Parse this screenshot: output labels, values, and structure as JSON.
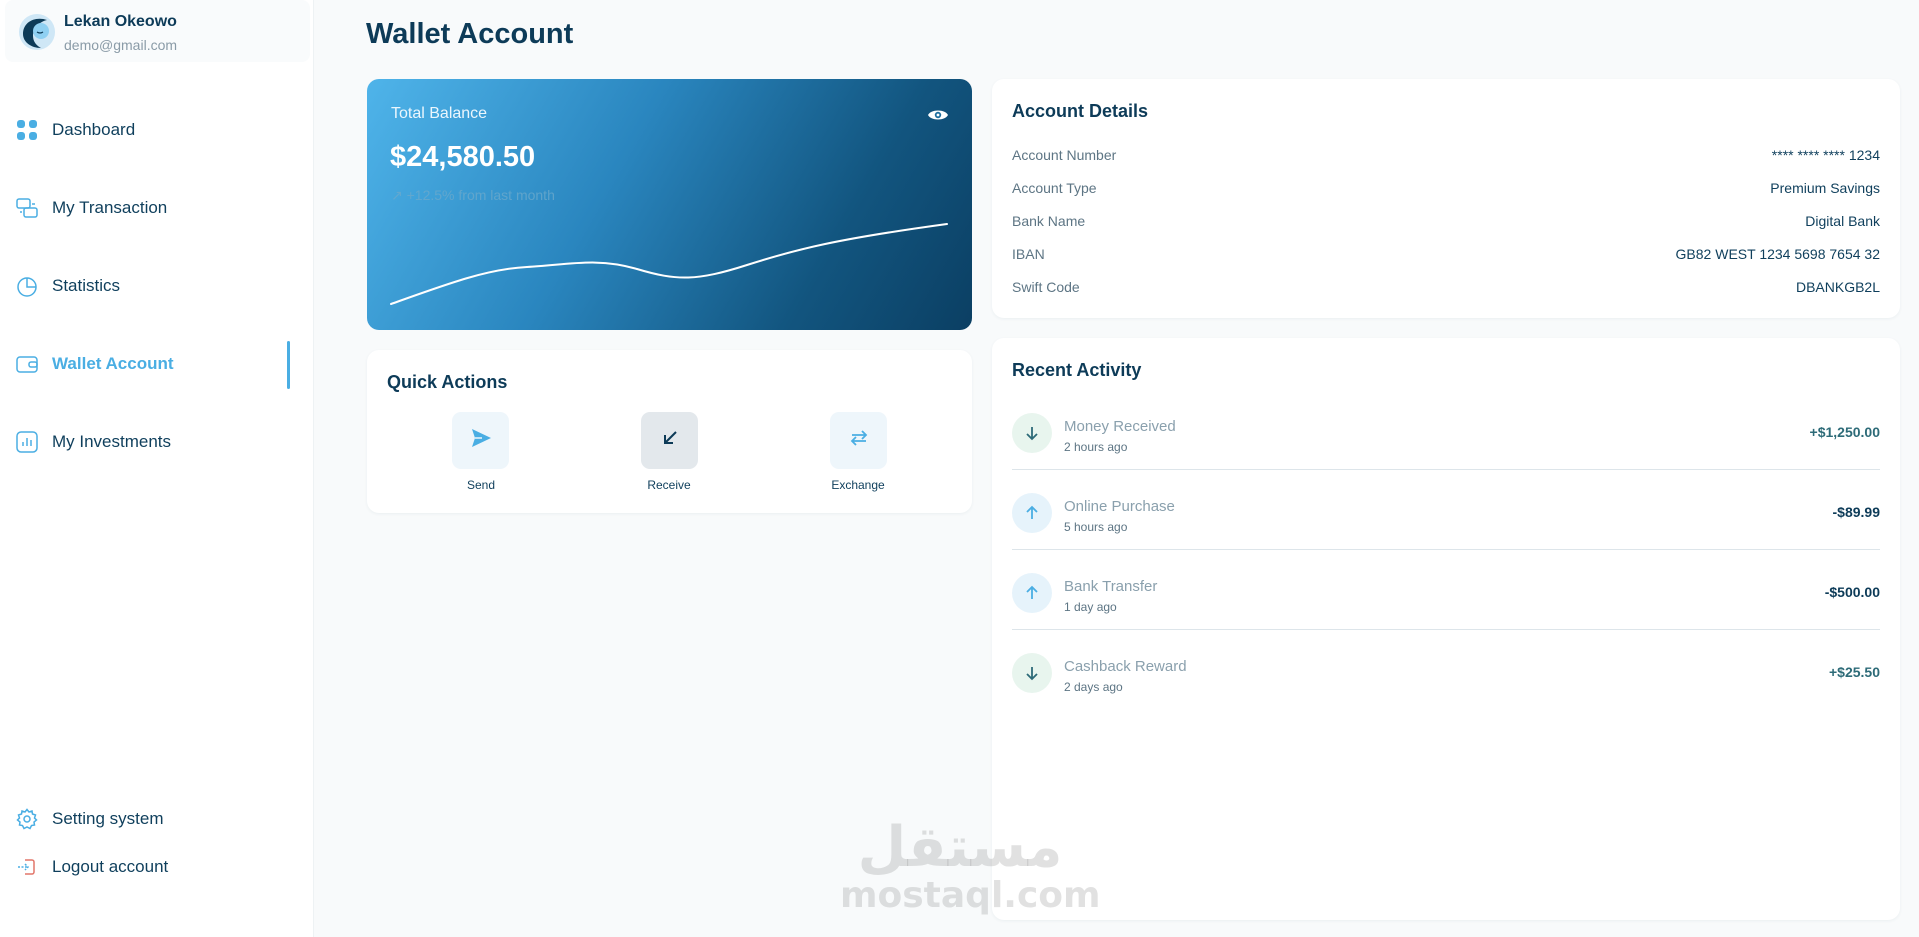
{
  "profile": {
    "name": "Lekan Okeowo",
    "email": "demo@gmail.com"
  },
  "nav": {
    "items": [
      {
        "label": "Dashboard",
        "icon": "grid-icon"
      },
      {
        "label": "My Transaction",
        "icon": "transaction-icon"
      },
      {
        "label": "Statistics",
        "icon": "pie-chart-icon"
      },
      {
        "label": "Wallet Account",
        "icon": "wallet-icon",
        "active": true
      },
      {
        "label": "My Investments",
        "icon": "bar-chart-icon"
      }
    ],
    "settings": "Setting system",
    "logout": "Logout account"
  },
  "page": {
    "title": "Wallet Account"
  },
  "balance": {
    "label": "Total Balance",
    "amount": "$24,580.50",
    "change": "+12.5% from last month",
    "change_icon": "trend-up-icon"
  },
  "quick_actions": {
    "title": "Quick Actions",
    "items": [
      {
        "label": "Send",
        "icon": "send-icon"
      },
      {
        "label": "Receive",
        "icon": "arrow-down-left-icon",
        "selected": true
      },
      {
        "label": "Exchange",
        "icon": "exchange-icon"
      }
    ]
  },
  "account": {
    "title": "Account Details",
    "rows": [
      {
        "key": "Account Number",
        "value": "**** **** **** 1234"
      },
      {
        "key": "Account Type",
        "value": "Premium Savings"
      },
      {
        "key": "Bank Name",
        "value": "Digital Bank"
      },
      {
        "key": "IBAN",
        "value": "GB82 WEST 1234 5698 7654 32"
      },
      {
        "key": "Swift Code",
        "value": "DBANKGB2L"
      }
    ]
  },
  "activity": {
    "title": "Recent Activity",
    "items": [
      {
        "title": "Money Received",
        "time": "2 hours ago",
        "amount": "+$1,250.00",
        "direction": "in"
      },
      {
        "title": "Online Purchase",
        "time": "5 hours ago",
        "amount": "-$89.99",
        "direction": "out"
      },
      {
        "title": "Bank Transfer",
        "time": "1 day ago",
        "amount": "-$500.00",
        "direction": "out"
      },
      {
        "title": "Cashback Reward",
        "time": "2 days ago",
        "amount": "+$25.50",
        "direction": "in"
      }
    ]
  },
  "watermark": {
    "arabic": "مستقل",
    "latin": "mostaql.com"
  },
  "colors": {
    "accent": "#4aaee3",
    "navy": "#0d3b58",
    "positive": "#2d6b78"
  }
}
